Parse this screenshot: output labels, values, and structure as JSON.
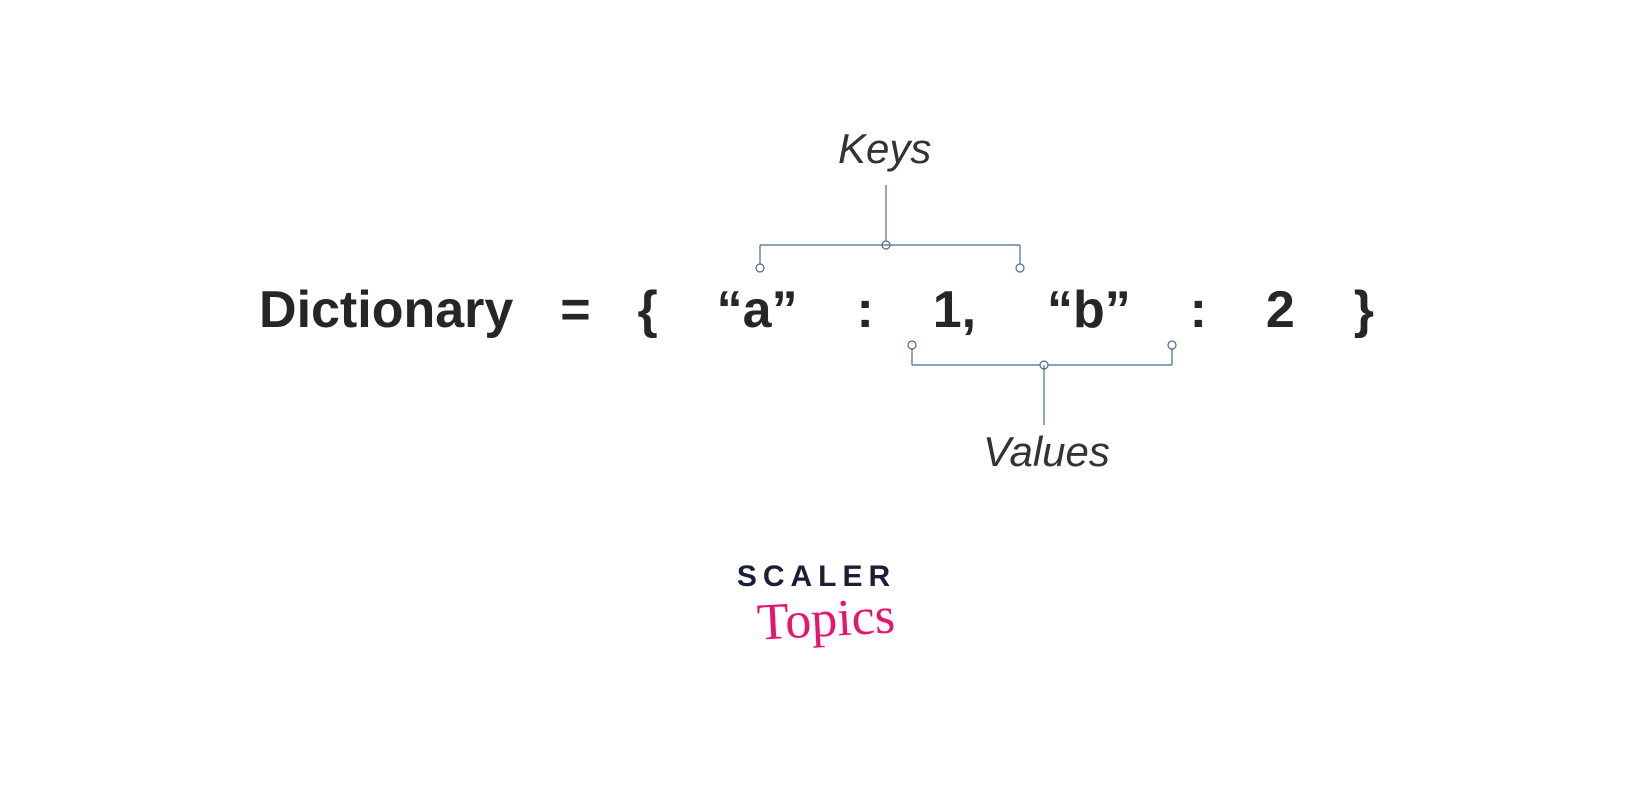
{
  "annotations": {
    "keys_label": "Keys",
    "values_label": "Values"
  },
  "code": {
    "var_name": "Dictionary",
    "equals": "=",
    "open_brace": "{",
    "key1": "“a”",
    "colon1": ":",
    "val1": "1,",
    "key2": "“b”",
    "colon2": ":",
    "val2": "2",
    "close_brace": "}"
  },
  "logo": {
    "line1": "SCALER",
    "line2": "Topics"
  },
  "colors": {
    "connector": "#4a6a8a",
    "text": "#262626",
    "logo_dark": "#1a1f36",
    "logo_pink": "#e6156f"
  }
}
